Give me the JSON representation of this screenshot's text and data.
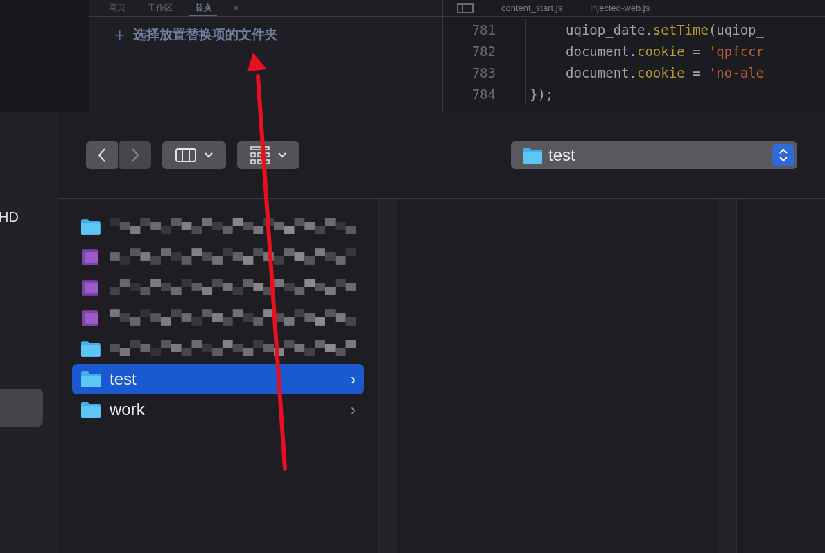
{
  "panel_tabs": [
    {
      "label": "网页",
      "selected": false
    },
    {
      "label": "工作区",
      "selected": false
    },
    {
      "label": "替换",
      "selected": true
    },
    {
      "label": "»",
      "selected": false
    }
  ],
  "add_folder": {
    "icon": "+",
    "label": "选择放置替换项的文件夹"
  },
  "editor_tabs": [
    {
      "label": "content_start.js"
    },
    {
      "label": "injected-web.js"
    }
  ],
  "code_lines": [
    {
      "number": "781",
      "kind": "inner",
      "tokens": [
        {
          "kind": "plain",
          "text": "uqiop_date."
        },
        {
          "kind": "method",
          "text": "setTime"
        },
        {
          "kind": "plain",
          "text": "(uqiop_"
        }
      ]
    },
    {
      "number": "782",
      "kind": "inner",
      "tokens": [
        {
          "kind": "plain",
          "text": "document."
        },
        {
          "kind": "method",
          "text": "cookie"
        },
        {
          "kind": "plain",
          "text": " = "
        },
        {
          "kind": "string",
          "text": "'qpfccr"
        }
      ]
    },
    {
      "number": "783",
      "kind": "inner",
      "tokens": [
        {
          "kind": "plain",
          "text": "document."
        },
        {
          "kind": "method",
          "text": "cookie"
        },
        {
          "kind": "plain",
          "text": " = "
        },
        {
          "kind": "string",
          "text": "'no-ale"
        }
      ]
    },
    {
      "number": "784",
      "kind": "outer",
      "tokens": [
        {
          "kind": "plain",
          "text": "});"
        }
      ]
    }
  ],
  "sidebar": {
    "label": "HD"
  },
  "location": {
    "label": "test"
  },
  "files": [
    {
      "kind": "folder",
      "redacted": true,
      "selected": false
    },
    {
      "kind": "archive",
      "redacted": true,
      "selected": false
    },
    {
      "kind": "archive",
      "redacted": true,
      "selected": false
    },
    {
      "kind": "archive",
      "redacted": true,
      "selected": false
    },
    {
      "kind": "folder",
      "redacted": true,
      "selected": false
    },
    {
      "kind": "folder",
      "name": "test",
      "selected": true,
      "chevron": "›"
    },
    {
      "kind": "folder",
      "name": "work",
      "selected": false,
      "chevron": "›"
    }
  ]
}
